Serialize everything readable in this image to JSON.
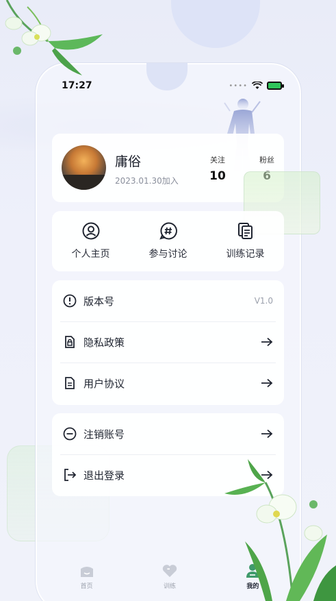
{
  "status_bar": {
    "time": "17:27"
  },
  "profile": {
    "username": "庸俗",
    "join_date": "2023.01.30加入",
    "following_label": "关注",
    "following_count": "10",
    "fans_label": "粉丝",
    "fans_count": "6"
  },
  "shortcuts": [
    {
      "label": "个人主页",
      "icon": "user-icon"
    },
    {
      "label": "参与讨论",
      "icon": "hashtag-icon"
    },
    {
      "label": "训练记录",
      "icon": "document-copy-icon"
    }
  ],
  "menu": [
    {
      "label": "版本号",
      "value": "V1.0",
      "icon": "info-icon"
    },
    {
      "label": "隐私政策",
      "icon": "lock-document-icon"
    },
    {
      "label": "用户协议",
      "icon": "document-icon"
    }
  ],
  "menu2": [
    {
      "label": "注销账号",
      "icon": "minus-circle-icon"
    },
    {
      "label": "退出登录",
      "icon": "logout-icon"
    }
  ],
  "tabbar": [
    {
      "label": "首页",
      "icon": "home-icon",
      "active": false
    },
    {
      "label": "训练",
      "icon": "heart-icon",
      "active": false
    },
    {
      "label": "我的",
      "icon": "profile-icon",
      "active": true
    }
  ],
  "colors": {
    "accent_green": "#3f9a6b",
    "background": "#eef0fa"
  }
}
